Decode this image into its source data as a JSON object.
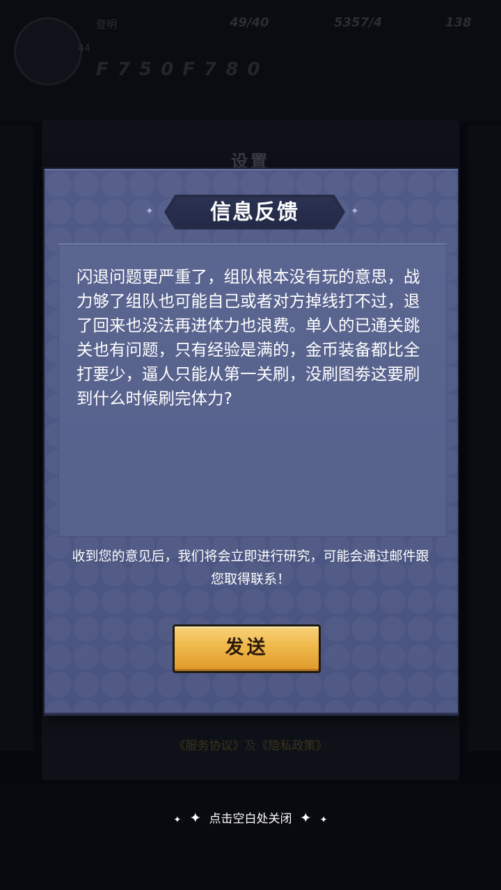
{
  "background": {
    "player_level": "44",
    "player_name": "登明",
    "stats": [
      "49/40",
      "5357/4",
      "138"
    ],
    "power": "F 7 5 0 F 7 8 0",
    "panel_title": "设置",
    "agreement_link": "《服务协议》",
    "and_text": "及",
    "privacy_link": "《隐私政策》"
  },
  "dialog": {
    "title": "信息反馈",
    "feedback_text": "闪退问题更严重了，组队根本没有玩的意思，战力够了组队也可能自己或者对方掉线打不过，退了回来也没法再进体力也浪费。单人的已通关跳关也有问题，只有经验是满的，金币装备都比全打要少，逼人只能从第一关刷，没刷图劵这要刷到什么时候刷完体力?",
    "notice": "收到您的意见后，我们将会立即进行研究，可能会通过邮件跟您取得联系！",
    "send_label": "发送"
  },
  "close_hint": "点击空白处关闭",
  "colors": {
    "dialog_bg": "#4d5782",
    "feedback_bg": "#5a6590",
    "button_top": "#f8d27a",
    "button_bottom": "#e09a2a",
    "title_banner": "#252b48"
  },
  "icons": {
    "sparkle": "four-point-star-icon"
  }
}
